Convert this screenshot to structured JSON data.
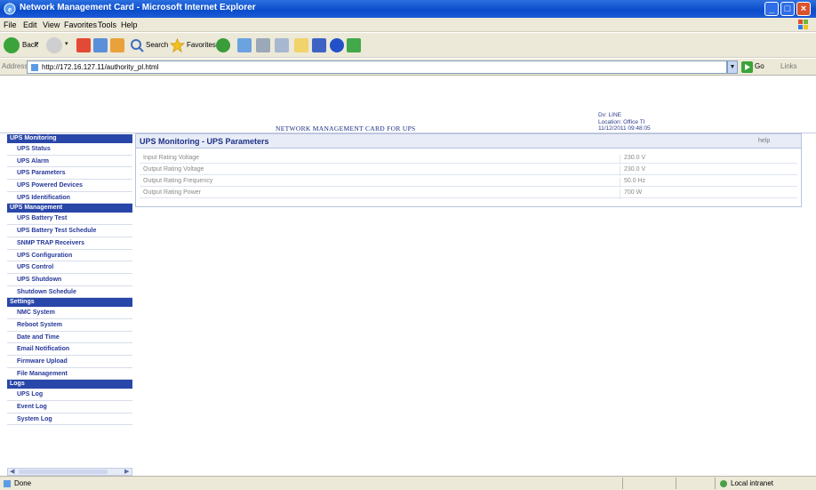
{
  "window": {
    "title": "Network Management Card - Microsoft Internet Explorer"
  },
  "menu": [
    "File",
    "Edit",
    "View",
    "Favorites",
    "Tools",
    "Help"
  ],
  "toolbar": {
    "back_label": "Back",
    "search_label": "Search",
    "favorites_label": "Favorites"
  },
  "address": {
    "label": "Address",
    "url": "http://172.16.127.11/authority_pl.html",
    "go_label": "Go",
    "links_label": "Links"
  },
  "header": {
    "title": "NETWORK MANAGEMENT CARD FOR UPS",
    "info_line1": "Dv: LINE",
    "info_line2": "Location: Office TI",
    "info_line3": "11/12/2011 09:48:05"
  },
  "sidebar": {
    "groups": [
      {
        "label": "UPS Monitoring",
        "items": [
          "UPS Status",
          "UPS Alarm",
          "UPS Parameters",
          "UPS Powered Devices",
          "UPS Identification"
        ]
      },
      {
        "label": "UPS Management",
        "items": [
          "UPS Battery Test",
          "UPS Battery Test Schedule",
          "SNMP TRAP Receivers",
          "UPS Configuration",
          "UPS Control",
          "UPS Shutdown",
          "Shutdown Schedule"
        ]
      },
      {
        "label": "Settings",
        "items": [
          "NMC System",
          "Reboot System",
          "Date and Time",
          "Email Notification",
          "Firmware Upload",
          "File Management"
        ]
      },
      {
        "label": "Logs",
        "items": [
          "UPS Log",
          "Event Log",
          "System Log"
        ]
      }
    ]
  },
  "panel": {
    "title": "UPS Monitoring - UPS Parameters",
    "help": "help",
    "rows": [
      {
        "label": "Input Rating Voltage",
        "value": "230.0 V"
      },
      {
        "label": "Output Rating Voltage",
        "value": "230.0 V"
      },
      {
        "label": "Output Rating Frequency",
        "value": "50.0 Hz"
      },
      {
        "label": "Output Rating Power",
        "value": "700 W"
      }
    ]
  },
  "status": {
    "text": "Done",
    "zone": "Local intranet"
  },
  "colors": {
    "titlebar": "#0a4cc9",
    "sidebar_group": "#2946a9",
    "sidebar_text": "#26389a",
    "panel_title": "#1d2f86"
  }
}
